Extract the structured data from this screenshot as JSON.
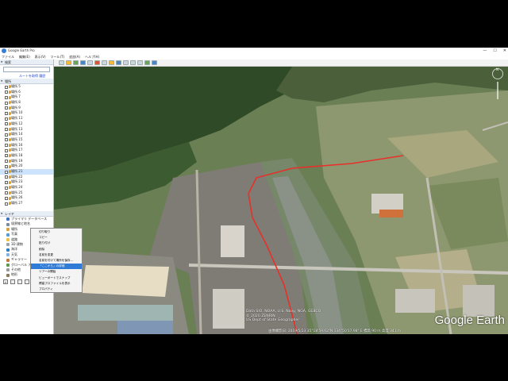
{
  "window": {
    "title": "Google Earth Pro",
    "controls": [
      "—",
      "☐",
      "✕"
    ]
  },
  "menu": [
    "ファイル",
    "編集(E)",
    "表示(V)",
    "ツール(T)",
    "追加(A)",
    "ヘルプ(H)"
  ],
  "search": {
    "header": "検索",
    "placeholder": "",
    "route_link": "ルートを取得   履歴"
  },
  "places": {
    "header": "場所",
    "items": [
      {
        "label": "場所 5"
      },
      {
        "label": "場所 6"
      },
      {
        "label": "場所 7"
      },
      {
        "label": "場所 8"
      },
      {
        "label": "場所 9"
      },
      {
        "label": "場所 10"
      },
      {
        "label": "場所 11"
      },
      {
        "label": "場所 12"
      },
      {
        "label": "場所 13"
      },
      {
        "label": "場所 14"
      },
      {
        "label": "場所 15"
      },
      {
        "label": "場所 16"
      },
      {
        "label": "場所 17"
      },
      {
        "label": "場所 18"
      },
      {
        "label": "場所 19"
      },
      {
        "label": "場所 20"
      },
      {
        "label": "場所 21",
        "selected": true
      },
      {
        "label": "場所 22"
      },
      {
        "label": "場所 23"
      },
      {
        "label": "場所 24"
      },
      {
        "label": "場所 25"
      },
      {
        "label": "場所 26"
      },
      {
        "label": "場所 27"
      }
    ]
  },
  "context_menu": {
    "items": [
      {
        "label": "切り取り"
      },
      {
        "label": "コピー"
      },
      {
        "label": "貼り付け"
      },
      {
        "label": "削除"
      },
      {
        "label": "名前を変更"
      },
      {
        "label": "名前を付けて場所を保存..."
      },
      {
        "label": "「ここから」の詳細",
        "highlighted": true
      },
      {
        "label": "ツアーの開始"
      },
      {
        "label": "ビューポートでスナップ"
      },
      {
        "label": "標高プロファイルを表示"
      },
      {
        "label": "プロパティ"
      }
    ]
  },
  "layers": {
    "header": "レイヤ",
    "items": [
      {
        "label": "プライマリ データベース",
        "color": "#3b73c4"
      },
      {
        "label": "境界線と地名",
        "color": "#7d8b9b"
      },
      {
        "label": "場所",
        "color": "#d9a23a"
      },
      {
        "label": "写真",
        "color": "#5a9bd4"
      },
      {
        "label": "道路",
        "color": "#f0c040"
      },
      {
        "label": "3D 建物",
        "color": "#9aa4ae"
      },
      {
        "label": "海洋",
        "color": "#2e7fc0"
      },
      {
        "label": "天気",
        "color": "#7fb3e0"
      },
      {
        "label": "ギャラリー",
        "color": "#c47a3b"
      },
      {
        "label": "グローバル アウェアネス",
        "color": "#5e9a50"
      },
      {
        "label": "その他",
        "color": "#999999"
      },
      {
        "label": "地形",
        "color": "#8a7a55"
      }
    ]
  },
  "map": {
    "copyright": [
      "Data SIO, NOAA, U.S. Navy, NGA, GEBCO",
      "© 2020 ZENRIN",
      "US Dept of State Geographer"
    ],
    "status": "画像撮影日: 2019/5/23    35°18'59.62\"N  134°50'17.98\" E  標高   90 m    高度   341 m",
    "brand": "Google Earth",
    "route_color": "#e8302a",
    "north_label": "N"
  }
}
